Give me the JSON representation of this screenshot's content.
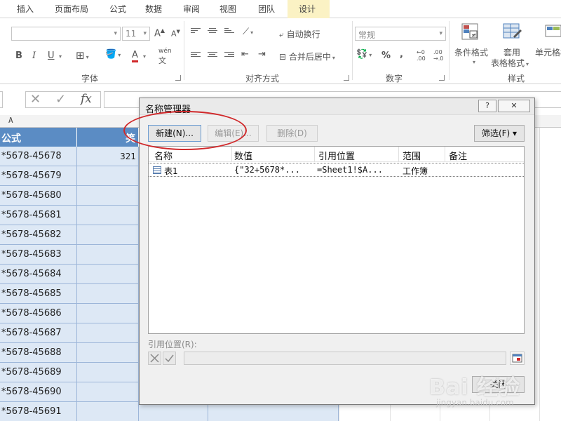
{
  "ribbon": {
    "tabs": [
      "插入",
      "页面布局",
      "公式",
      "数据",
      "审阅",
      "视图",
      "团队",
      "设计"
    ],
    "font_size": "11",
    "number_format": "常规",
    "wrap_text": "自动换行",
    "merge_center": "合并后居中",
    "percent": "%",
    "comma": ",",
    "conditional_format": "条件格式",
    "table_format_line1": "套用",
    "table_format_line2": "表格格式",
    "cell_styles": "单元格样",
    "groups": {
      "font": "字体",
      "alignment": "对齐方式",
      "number": "数字",
      "styles": "样式"
    },
    "bold": "B",
    "italic": "I",
    "underline": "U",
    "font_grow": "A",
    "font_shrink": "A",
    "font_color": "A",
    "phonetic": "wén"
  },
  "formula_bar": {
    "fx": "fx"
  },
  "grid": {
    "col_a_label": "A",
    "header_a": "公式",
    "header_b": "笑",
    "rows": [
      {
        "a": "*5678-45678",
        "b": "321"
      },
      {
        "a": "*5678-45679",
        "b": ""
      },
      {
        "a": "*5678-45680",
        "b": ""
      },
      {
        "a": "*5678-45681",
        "b": ""
      },
      {
        "a": "*5678-45682",
        "b": ""
      },
      {
        "a": "*5678-45683",
        "b": ""
      },
      {
        "a": "*5678-45684",
        "b": ""
      },
      {
        "a": "*5678-45685",
        "b": ""
      },
      {
        "a": "*5678-45686",
        "b": ""
      },
      {
        "a": "*5678-45687",
        "b": ""
      },
      {
        "a": "*5678-45688",
        "b": ""
      },
      {
        "a": "*5678-45689",
        "b": ""
      },
      {
        "a": "*5678-45690",
        "b": ""
      },
      {
        "a": "*5678-45691",
        "b": ""
      }
    ]
  },
  "dialog": {
    "title": "名称管理器",
    "help": "?",
    "close": "✕",
    "new_button": "新建(N)...",
    "edit_button": "编辑(E)...",
    "delete_button": "删除(D)",
    "filter_button": "筛选(F) ▾",
    "columns": [
      "名称",
      "数值",
      "引用位置",
      "范围",
      "备注"
    ],
    "entry": {
      "name": "表1",
      "value": "{\"32+5678*...",
      "refers_to": "=Sheet1!$A...",
      "scope": "工作簿",
      "comment": ""
    },
    "refers_to_label": "引用位置(R):",
    "close_button": "关闭"
  },
  "watermark": {
    "text": "Bai 经验",
    "url": "jingyan.baidu.com"
  },
  "colors": {
    "accent_green": "#217346",
    "header_blue": "#5b8cc4",
    "selection_blue": "#dde8f5",
    "annotation_red": "#d0282a",
    "design_tab_bg": "#fbf2c4"
  }
}
